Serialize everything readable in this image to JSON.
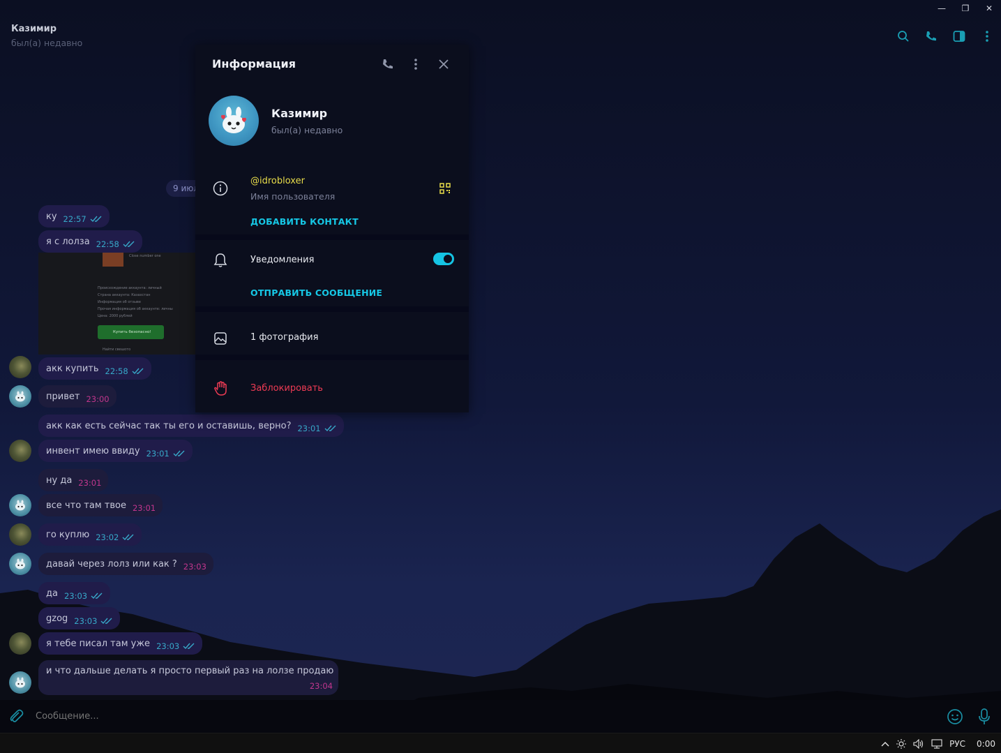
{
  "window": {
    "minimize": "—",
    "maximize": "❐",
    "close": "✕"
  },
  "chat": {
    "title": "Казимир",
    "status": "был(а) недавно"
  },
  "messages": {
    "date": "9 июл",
    "items": [
      {
        "text": "ку",
        "time": "22:57",
        "dir": "out"
      },
      {
        "text": "я с лолза",
        "time": "22:58",
        "dir": "out"
      },
      {
        "text": "акк купить",
        "time": "22:58",
        "dir": "out"
      },
      {
        "text": "привет",
        "time": "23:00",
        "dir": "in"
      },
      {
        "text": "акк как есть сейчас так ты его и оставишь, верно?",
        "time": "23:01",
        "dir": "out"
      },
      {
        "text": "инвент имею ввиду",
        "time": "23:01",
        "dir": "out"
      },
      {
        "text": "ну да",
        "time": "23:01",
        "dir": "in"
      },
      {
        "text": "все что там твое",
        "time": "23:01",
        "dir": "in"
      },
      {
        "text": "го куплю",
        "time": "23:02",
        "dir": "out"
      },
      {
        "text": "давай через лолз или как ?",
        "time": "23:03",
        "dir": "in"
      },
      {
        "text": "да",
        "time": "23:03",
        "dir": "out"
      },
      {
        "text": "gzog",
        "time": "23:03",
        "dir": "out"
      },
      {
        "text": "я тебе писал там уже",
        "time": "23:03",
        "dir": "out"
      },
      {
        "text": "и что дальше делать я просто первый раз на лолзе продаю",
        "time": "23:04",
        "dir": "in"
      }
    ],
    "photo_lines": {
      "l1": "Close number one",
      "l2": "Происхождение аккаунта: личный",
      "l3": "Страна аккаунта: Казахстан",
      "l4": "Информация об отзыве",
      "l5": "Прочая информация об аккаунте: личны",
      "l6": "Цена: 2000 рублей",
      "buy": "Купить безопасно!",
      "find": "Найти свешото"
    }
  },
  "info_panel": {
    "title": "Информация",
    "name": "Казимир",
    "status": "был(а) недавно",
    "username": "@idrobloxer",
    "username_caption": "Имя пользователя",
    "add_contact": "ДОБАВИТЬ КОНТАКТ",
    "notifications": "Уведомления",
    "notifications_on": true,
    "send_message": "ОТПРАВИТЬ СООБЩЕНИЕ",
    "photos": "1 фотография",
    "block": "Заблокировать"
  },
  "composer": {
    "placeholder": "Сообщение..."
  },
  "taskbar": {
    "lang": "РУС",
    "time": "0:00"
  },
  "colors": {
    "accent": "#16c8e6",
    "out_time": "#37a9c9",
    "in_time": "#c2368d",
    "danger": "#ef3b54",
    "username": "#e9dd4a"
  }
}
